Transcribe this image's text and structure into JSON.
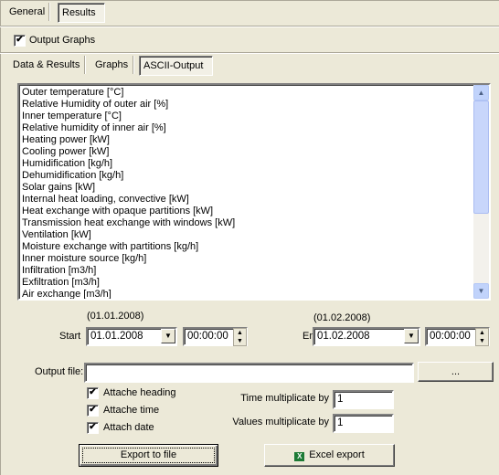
{
  "top_tabs": [
    {
      "label": "General",
      "active": false
    },
    {
      "label": "Results",
      "active": true
    }
  ],
  "output_graphs": {
    "label": "Output Graphs",
    "checked": true
  },
  "sub_tabs": [
    {
      "label": "Data & Results",
      "active": false
    },
    {
      "label": "Graphs",
      "active": false
    },
    {
      "label": "ASCII-Output",
      "active": true
    }
  ],
  "variables": [
    "Outer temperature [°C]",
    "Relative Humidity of outer air [%]",
    "Inner temperature [°C]",
    "Relative humidity of inner air [%]",
    "Heating power [kW]",
    "Cooling power [kW]",
    "Humidification [kg/h]",
    "Dehumidification [kg/h]",
    "Solar gains [kW]",
    "Internal heat loading, convective [kW]",
    "Heat exchange with opaque partitions [kW]",
    "Transmission heat exchange with windows [kW]",
    "Ventilation [kW]",
    "Moisture exchange with partitions [kg/h]",
    "Inner moisture source [kg/h]",
    "Infiltration [m3/h]",
    "Exfiltration [m3/h]",
    "Air exchange [m3/h]"
  ],
  "start": {
    "hint": "(01.01.2008)",
    "label": "Start",
    "date": "01.01.2008",
    "time": "00:00:00"
  },
  "end": {
    "hint": "(01.02.2008)",
    "label": "End",
    "date": "01.02.2008",
    "time": "00:00:00"
  },
  "output_file": {
    "label": "Output file:",
    "value": "",
    "browse_label": "..."
  },
  "options": [
    {
      "label": "Attache heading",
      "checked": true
    },
    {
      "label": "Attache time",
      "checked": true
    },
    {
      "label": "Attach date",
      "checked": true
    }
  ],
  "time_mult": {
    "label": "Time multiplicate by",
    "value": "1"
  },
  "values_mult": {
    "label": "Values multiplicate by",
    "value": "1"
  },
  "export_label": "Export to file",
  "excel_label": "Excel export",
  "excel_icon_color": "#1d7a35"
}
